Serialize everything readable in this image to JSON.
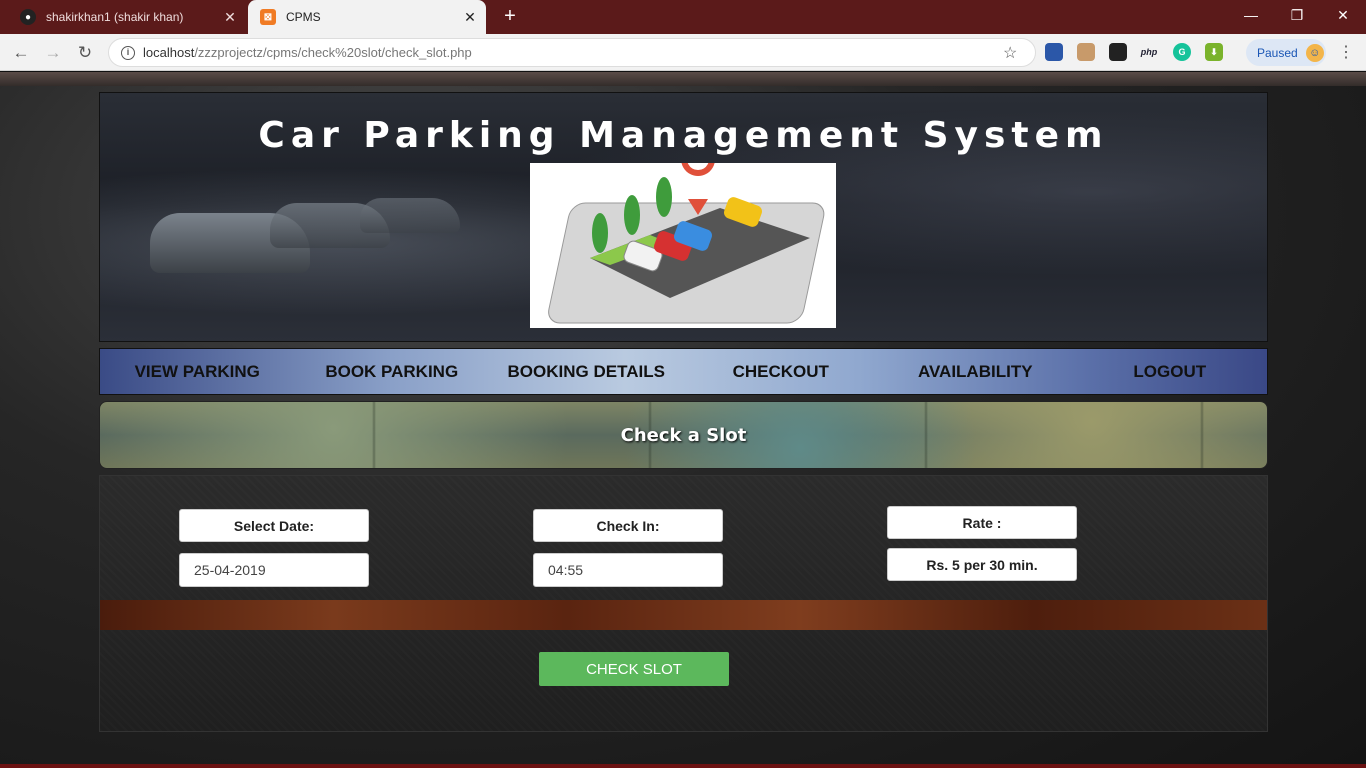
{
  "browser": {
    "tabs": [
      {
        "title": "shakirkhan1 (shakir khan)",
        "close": "✕"
      },
      {
        "title": "CPMS",
        "close": "✕"
      }
    ],
    "new_tab": "+",
    "window_controls": {
      "minimize": "—",
      "maximize": "❐",
      "close": "✕"
    },
    "nav": {
      "back": "←",
      "forward": "→",
      "reload": "↻"
    },
    "url_host": "localhost",
    "url_path": "/zzzprojectz/cpms/check%20slot/check_slot.php",
    "extensions": [
      {
        "name": "ext-1-icon",
        "color": "#2b57a8",
        "label": ""
      },
      {
        "name": "ext-2-icon",
        "color": "#c89a6a",
        "label": ""
      },
      {
        "name": "ext-3-icon",
        "color": "#222222",
        "label": ""
      },
      {
        "name": "php-icon",
        "color": "#f2f2f2",
        "label": "php"
      },
      {
        "name": "grammarly-icon",
        "color": "#15c39a",
        "label": "G"
      },
      {
        "name": "download-icon",
        "color": "#7ab32b",
        "label": "⬇"
      }
    ],
    "profile_label": "Paused",
    "menu": "⋮"
  },
  "site": {
    "title": "Car Parking Management System",
    "nav": [
      "VIEW PARKING",
      "BOOK PARKING",
      "BOOKING DETAILS",
      "CHECKOUT",
      "AVAILABILITY",
      "LOGOUT"
    ],
    "banner_title": "Check a Slot"
  },
  "form": {
    "date_label": "Select Date:",
    "date_value": "25-04-2019",
    "checkin_label": "Check In:",
    "checkin_value": "04:55",
    "rate_label": "Rate :",
    "rate_value": "Rs. 5 per 30 min.",
    "submit_label": "CHECK SLOT"
  },
  "colors": {
    "tabstrip": "#5b1a1a",
    "submit_button": "#5cb85c",
    "nav_gradient_mid": "#b9cae0"
  }
}
